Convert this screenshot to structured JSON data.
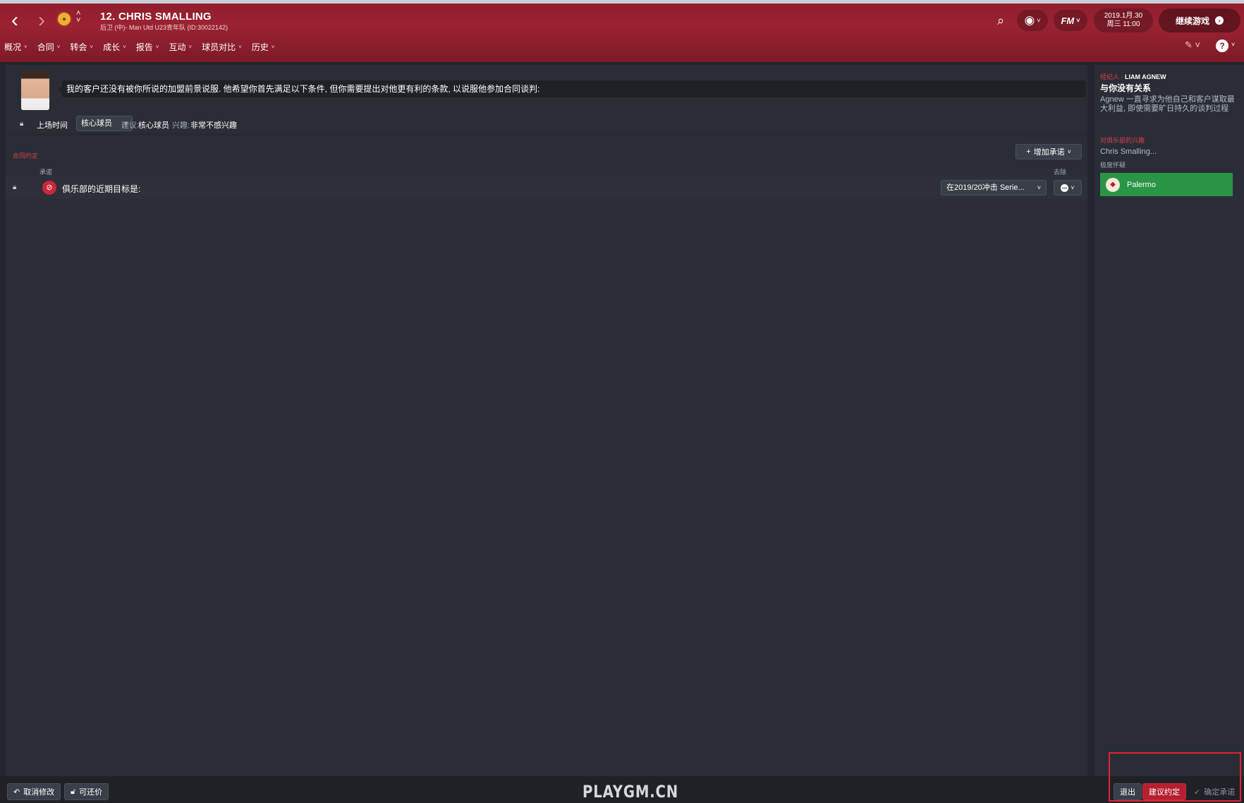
{
  "header": {
    "player_title": "12. CHRIS SMALLING",
    "player_subtitle": "后卫 (中)- Man Utd U23青年队 (ID:30022142)",
    "date_line1": "2019.1月.30",
    "date_line2": "周三 11:00",
    "continue_label": "继续游戏",
    "fm_label": "FM"
  },
  "menu": [
    {
      "label": "概况"
    },
    {
      "label": "合同"
    },
    {
      "label": "转会"
    },
    {
      "label": "成长"
    },
    {
      "label": "报告"
    },
    {
      "label": "互动"
    },
    {
      "label": "球员对比"
    },
    {
      "label": "历史"
    }
  ],
  "negotiation": {
    "message": "我的客户还没有被你所说的加盟前景说服. 他希望你首先满足以下条件, 但你需要提出对他更有利的条款, 以说服他参加合同谈判:",
    "playing_time_label": "上场时间",
    "playing_time_value": "核心球员",
    "suggestion_label": "建议:",
    "suggestion_value": "核心球员",
    "interest_label": "兴趣:",
    "interest_value": "非常不感兴趣"
  },
  "promises": {
    "section_title": "合同约定",
    "add_button": "增加承诺",
    "col_promise": "承诺",
    "col_remove": "去除",
    "rows": [
      {
        "text": "俱乐部的近期目标是:",
        "value": "在2019/20冲击 Serie..."
      }
    ]
  },
  "agent_panel": {
    "agent_prefix": "经纪人 - ",
    "agent_name": "LIAM AGNEW",
    "relation": "与你没有关系",
    "description": "Agnew 一直寻求为他自己和客户谋取最大利益, 即使需要旷日持久的谈判过程",
    "interest_title": "对俱乐部的兴趣",
    "interest_player": "Chris Smalling...",
    "interest_level": "极度怀疑",
    "club_name": "Palermo"
  },
  "bottom": {
    "undo_label": "取消修改",
    "negotiable_label": "可还价",
    "watermark": "PLAYGM.CN",
    "exit_label": "退出",
    "propose_label": "建议约定",
    "confirm_label": "确定承诺"
  },
  "colors": {
    "header_red": "#9b2232",
    "accent_red": "#d7404e",
    "club_green": "#2a9447",
    "panel_bg": "#2a2d36"
  }
}
